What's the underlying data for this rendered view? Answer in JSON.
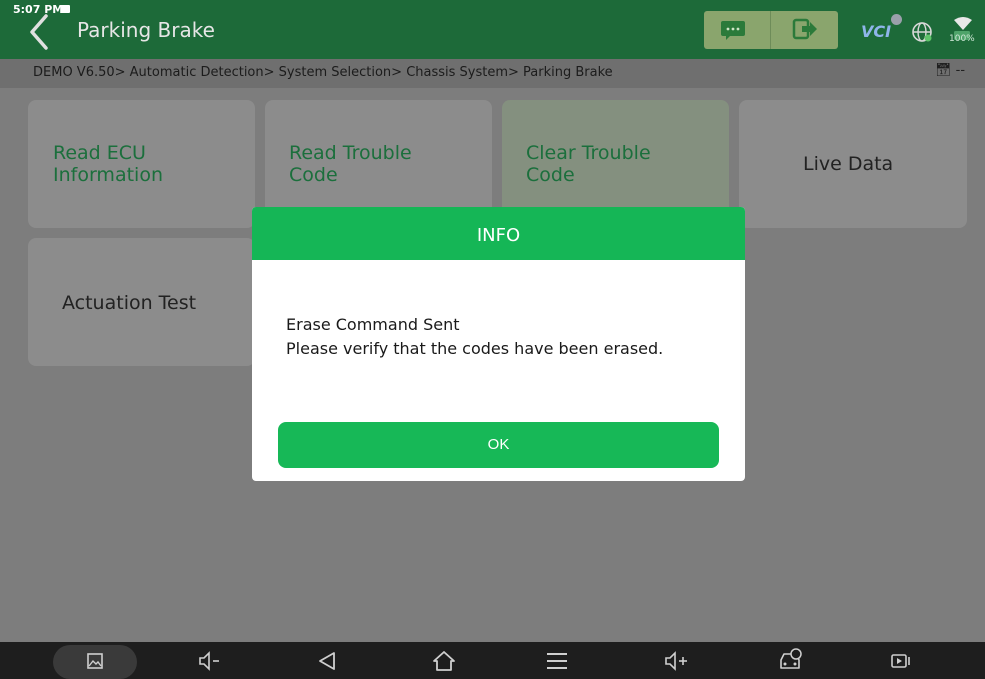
{
  "status": {
    "time": "5:07 PM",
    "battery": "100%"
  },
  "header": {
    "title": "Parking Brake",
    "vci_label": "VCI"
  },
  "breadcrumb": {
    "path": "DEMO V6.50> Automatic Detection> System Selection> Chassis System> Parking Brake",
    "right_text": "--"
  },
  "tiles": [
    {
      "line1": "Read ECU",
      "line2": "Information"
    },
    {
      "line1": "Read Trouble",
      "line2": "Code"
    },
    {
      "line1": "Clear Trouble",
      "line2": "Code"
    },
    {
      "label": "Live Data"
    },
    {
      "label": "Actuation Test"
    }
  ],
  "dialog": {
    "title": "INFO",
    "line1": "Erase Command Sent",
    "line2": "Please verify that the codes have been erased.",
    "ok_label": "OK"
  },
  "navbar": {
    "icons": [
      "screenshot-icon",
      "volume-down-icon",
      "back-icon",
      "home-icon",
      "menu-icon",
      "volume-up-icon",
      "car-diagnostic-icon",
      "screen-record-icon"
    ]
  },
  "colors": {
    "header": "#1d6a39",
    "accent": "#15b656",
    "tile_text": "#1b6f3c"
  }
}
